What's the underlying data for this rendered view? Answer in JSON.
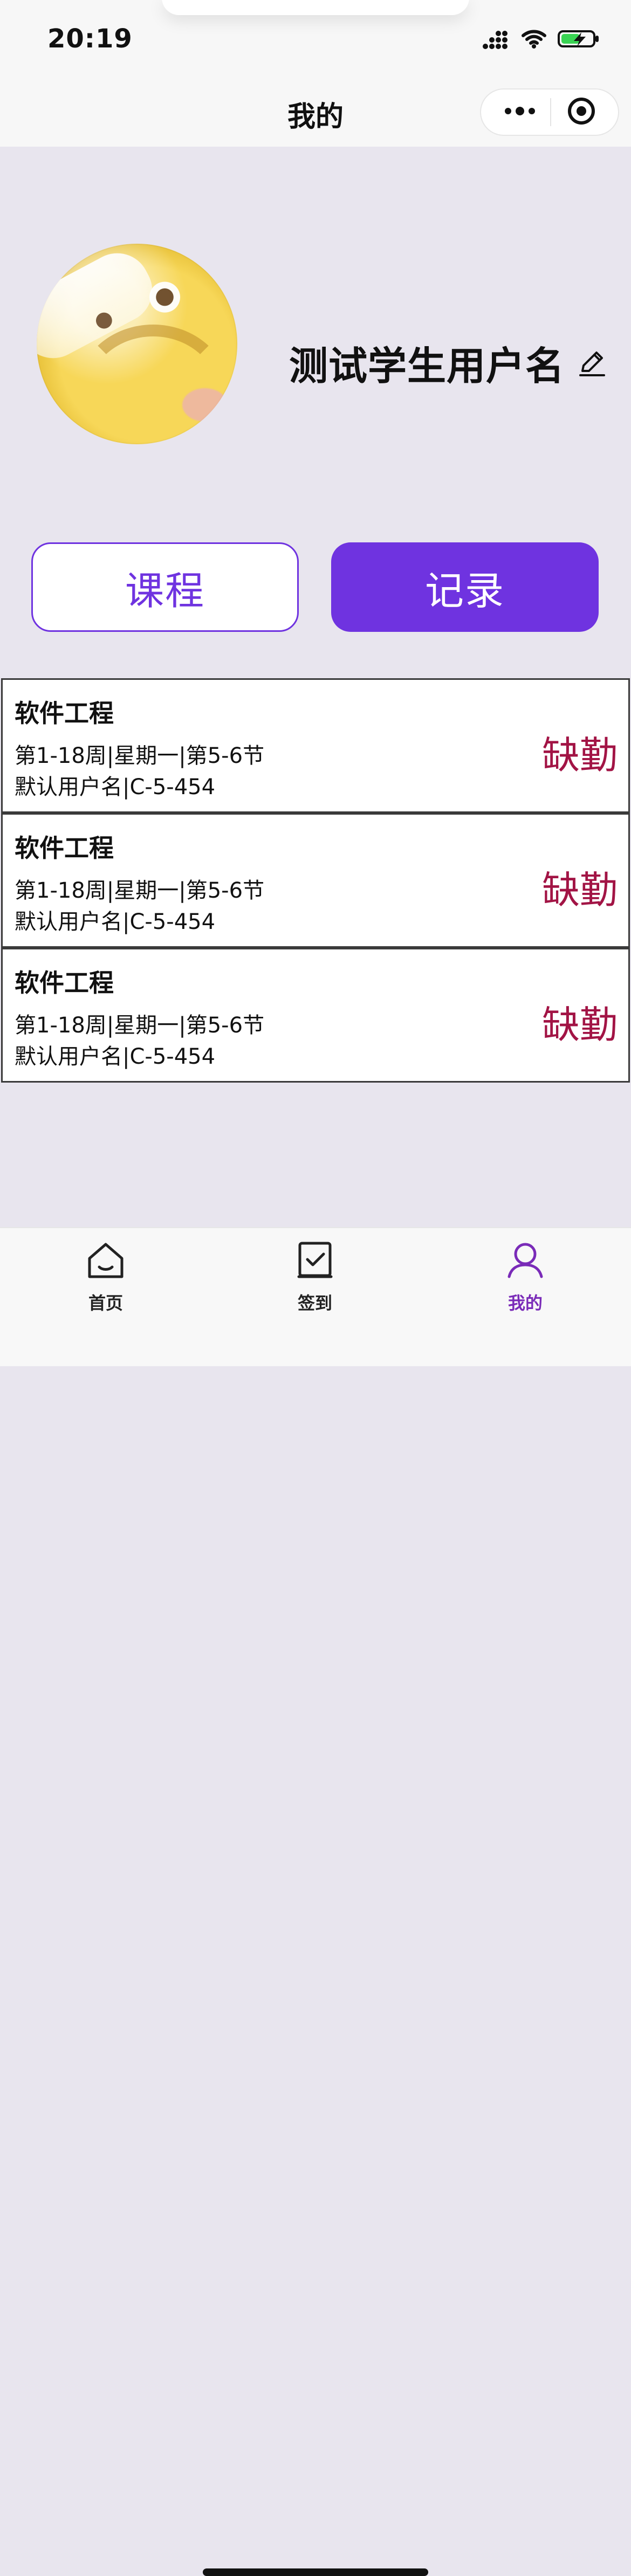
{
  "status_bar": {
    "time": "20:19",
    "icons": [
      "signal-icon",
      "wifi-icon",
      "battery-charging-icon"
    ]
  },
  "nav": {
    "title": "我的",
    "capsule": {
      "more_icon": "more-dots-icon",
      "close_icon": "record-target-icon"
    }
  },
  "profile": {
    "avatar_icon": "avatar-image",
    "username": "测试学生用户名",
    "edit_icon": "pencil-icon"
  },
  "tabs": {
    "course_label": "课程",
    "record_label": "记录",
    "active": "record"
  },
  "records": [
    {
      "course": "软件工程",
      "line1": "第1-18周|星期一|第5-6节",
      "line2": "默认用户名|C-5-454",
      "status": "缺勤"
    },
    {
      "course": "软件工程",
      "line1": "第1-18周|星期一|第5-6节",
      "line2": "默认用户名|C-5-454",
      "status": "缺勤"
    },
    {
      "course": "软件工程",
      "line1": "第1-18周|星期一|第5-6节",
      "line2": "默认用户名|C-5-454",
      "status": "缺勤"
    }
  ],
  "tabbar": {
    "items": [
      {
        "label": "首页",
        "icon": "home-icon"
      },
      {
        "label": "签到",
        "icon": "checkbox-icon"
      },
      {
        "label": "我的",
        "icon": "user-icon"
      }
    ],
    "active_index": 2,
    "colors": {
      "active": "#7a2bb8",
      "inactive": "#222222"
    }
  },
  "colors": {
    "page_bg": "#e8e5ee",
    "accent": "#6f33e0",
    "absent": "#a21445"
  }
}
